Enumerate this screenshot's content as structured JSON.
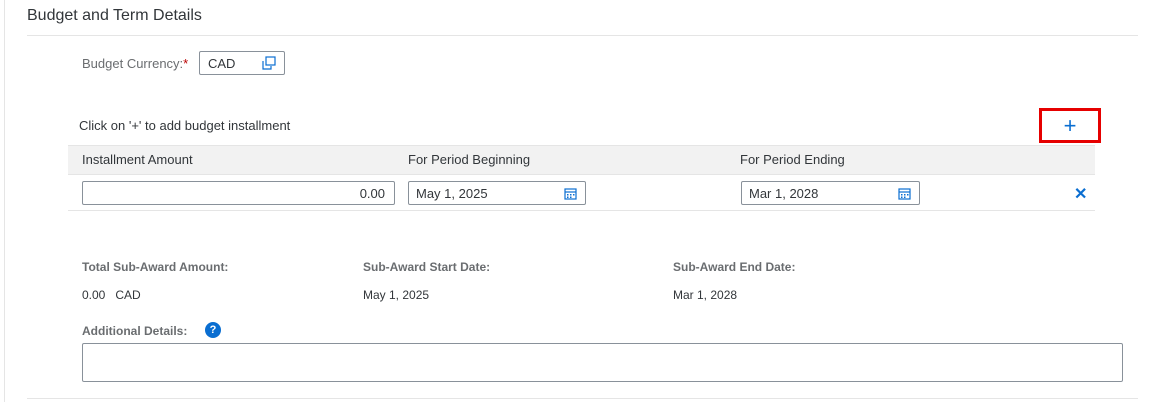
{
  "section": {
    "title": "Budget and Term Details"
  },
  "currency": {
    "label": "Budget Currency:",
    "required_mark": "*",
    "value": "CAD",
    "icon": "value-help-icon"
  },
  "installments": {
    "hint": "Click on '+' to add budget installment",
    "add_label": "+",
    "columns": [
      "Installment Amount",
      "For Period Beginning",
      "For Period Ending"
    ],
    "rows": [
      {
        "amount": "0.00",
        "begin": "May 1, 2025",
        "end": "Mar 1, 2028",
        "delete_label": "✕"
      }
    ]
  },
  "summary": {
    "total_label": "Total Sub-Award Amount:",
    "total_value": "0.00   CAD",
    "start_label": "Sub-Award Start Date:",
    "start_value": "May 1, 2025",
    "end_label": "Sub-Award End Date:",
    "end_value": "Mar 1, 2028"
  },
  "additional": {
    "label": "Additional Details:",
    "help_label": "?",
    "value": ""
  },
  "colors": {
    "accent": "#0a6ed1",
    "highlight": "#e60000",
    "required": "#bb0000"
  }
}
